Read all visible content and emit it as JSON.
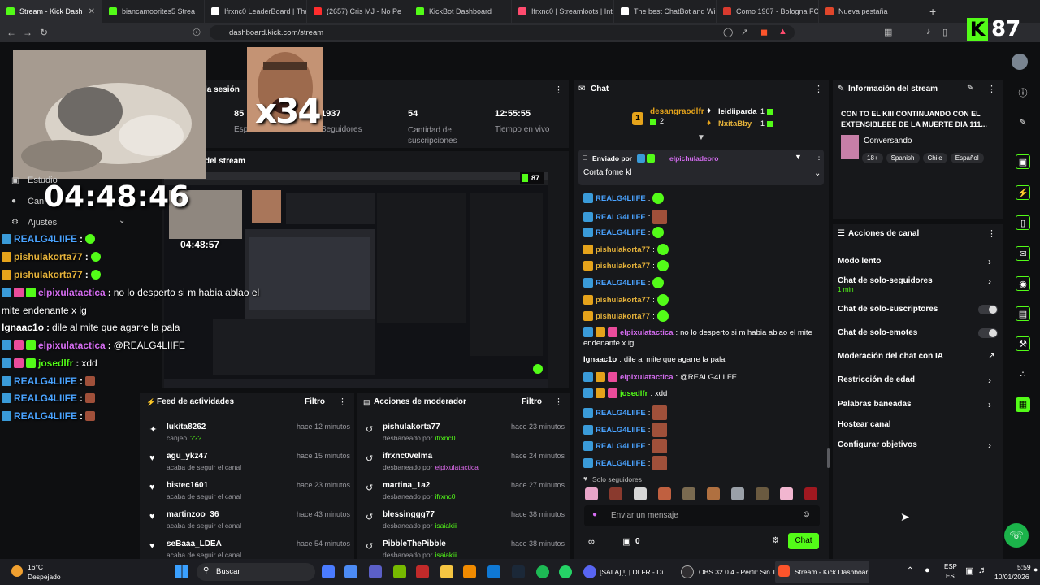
{
  "browser": {
    "tabs": [
      {
        "title": "Stream - Kick Dash",
        "color": "#53fc18",
        "active": true
      },
      {
        "title": "biancamoorites5 Strea",
        "color": "#53fc18"
      },
      {
        "title": "Ifrxnc0 LeaderBoard | The",
        "color": "#ffffff"
      },
      {
        "title": "(2657) Cris MJ - No Pe",
        "color": "#ff2d2d"
      },
      {
        "title": "KickBot Dashboard",
        "color": "#53fc18"
      },
      {
        "title": "Ifrxnc0 | Streamloots | Inte",
        "color": "#ff4b6e"
      },
      {
        "title": "The best ChatBot and Wi",
        "color": "#ffffff"
      },
      {
        "title": "Como 1907 - Bologna FC",
        "color": "#d83a2e"
      },
      {
        "title": "Nueva pestaña",
        "color": "#e0462b"
      }
    ],
    "new_tab": "+",
    "url": "dashboard.kick.com/stream",
    "kick_count": "87"
  },
  "stats": {
    "session_label": "la sesión",
    "items": [
      {
        "value": "85",
        "label": "Espectadores"
      },
      {
        "value": "1937",
        "label": "Seguidores"
      },
      {
        "value": "54",
        "label": "Cantidad de suscripciones"
      },
      {
        "value": "12:55:55",
        "label": "Tiempo en vivo"
      }
    ]
  },
  "overlay": {
    "multiplier": "x34",
    "clock": "04:48:46",
    "preview_title": "del stream",
    "menu_items": [
      "Estudio",
      "Can",
      "Ajustes"
    ],
    "chat": [
      {
        "user": "REALG4LIIFE",
        "sep": ":",
        "msg": "",
        "style": "blue",
        "emote": "green"
      },
      {
        "user": "pishulakorta77",
        "sep": ":",
        "msg": "",
        "style": "gold",
        "emote": "green"
      },
      {
        "user": "pishulakorta77",
        "sep": ":",
        "msg": "",
        "style": "gold",
        "emote": "green"
      },
      {
        "user": "elpixulatactica",
        "sep": ":",
        "msg": "no lo desperto si m habia ablao el",
        "style": "pink",
        "emote": ""
      },
      {
        "user": "",
        "sep": "",
        "msg": "mite endenante x ig",
        "style": "none",
        "emote": ""
      },
      {
        "user": "Ignaac1o",
        "sep": ":",
        "msg": "dile al mite que agarre la pala",
        "style": "plain",
        "emote": ""
      },
      {
        "user": "elpixulatactica",
        "sep": ":",
        "msg": "@REALG4LIIFE",
        "style": "pink",
        "emote": ""
      },
      {
        "user": "josedlfr",
        "sep": ":",
        "msg": "xdd",
        "style": "green",
        "emote": ""
      },
      {
        "user": "REALG4LIIFE",
        "sep": ":",
        "msg": "",
        "style": "blue",
        "emote": "red"
      },
      {
        "user": "REALG4LIIFE",
        "sep": ":",
        "msg": "",
        "style": "blue",
        "emote": "red"
      },
      {
        "user": "REALG4LIIFE",
        "sep": ":",
        "msg": "",
        "style": "blue",
        "emote": "red"
      }
    ],
    "preview_clock": "04:48:57"
  },
  "feed": {
    "title": "Feed de actividades",
    "filter": "Filtro",
    "items": [
      {
        "user": "lukita8262",
        "sub": "canjeó",
        "extra": "???",
        "time": "hace 12 minutos"
      },
      {
        "user": "agu_ykz47",
        "sub": "acaba de seguir el canal",
        "extra": "",
        "time": "hace 15 minutos"
      },
      {
        "user": "bistec1601",
        "sub": "acaba de seguir el canal",
        "extra": "",
        "time": "hace 23 minutos"
      },
      {
        "user": "martinzoo_36",
        "sub": "acaba de seguir el canal",
        "extra": "",
        "time": "hace 43 minutos"
      },
      {
        "user": "seBaaa_LDEA",
        "sub": "acaba de seguir el canal",
        "extra": "",
        "time": "hace 54 minutos"
      }
    ]
  },
  "mod": {
    "title": "Acciones de moderador",
    "filter": "Filtro",
    "items": [
      {
        "user": "pishulakorta77",
        "sub": "desbaneado por",
        "by": "ifrxnc0",
        "time": "hace 23 minutos"
      },
      {
        "user": "ifrxnc0velma",
        "sub": "desbaneado por",
        "by": "elpixulatactica",
        "time": "hace 24 minutos"
      },
      {
        "user": "martina_1a2",
        "sub": "desbaneado por",
        "by": "ifrxnc0",
        "time": "hace 27 minutos"
      },
      {
        "user": "blessinggg77",
        "sub": "desbaneado por",
        "by": "isaiakiii",
        "time": "hace 38 minutos"
      },
      {
        "user": "PibbleThePibble",
        "sub": "desbaneado por",
        "by": "isaiakiii",
        "time": "hace 38 minutos"
      }
    ]
  },
  "chat": {
    "title": "Chat",
    "top_gifters": [
      {
        "rank": "1",
        "name": "desangraodlfr",
        "count": "2"
      },
      {
        "name": "leidiiparda",
        "count": "1"
      },
      {
        "name": "NxitaBby",
        "count": "1"
      }
    ],
    "pinned_label": "Enviado por",
    "pinned_by": "elpichuladeoro",
    "pinned_msg": "Corta fome kl",
    "messages": [
      {
        "user": "REALG4LIIFE",
        "style": "blue",
        "msg": "",
        "emote": "green"
      },
      {
        "user": "REALG4LIIFE",
        "style": "blue",
        "msg": "",
        "emote": "red"
      },
      {
        "user": "REALG4LIIFE",
        "style": "blue",
        "msg": "",
        "emote": "green"
      },
      {
        "user": "pishulakorta77",
        "style": "gold",
        "msg": "",
        "emote": "green"
      },
      {
        "user": "pishulakorta77",
        "style": "gold",
        "msg": "",
        "emote": "green"
      },
      {
        "user": "REALG4LIIFE",
        "style": "blue",
        "msg": "",
        "emote": "green"
      },
      {
        "user": "pishulakorta77",
        "style": "gold",
        "msg": "",
        "emote": "green"
      },
      {
        "user": "pishulakorta77",
        "style": "gold",
        "msg": "",
        "emote": "green"
      },
      {
        "user": "elpixulatactica",
        "style": "pink",
        "msg": "no lo desperto si m habia ablao el mite",
        "emote": ""
      },
      {
        "user": "",
        "style": "none",
        "msg": "endenante x ig",
        "emote": ""
      },
      {
        "user": "Ignaac1o",
        "style": "plain",
        "msg": "dile al mite que agarre la pala",
        "emote": ""
      },
      {
        "user": "elpixulatactica",
        "style": "pink",
        "msg": "@REALG4LIIFE",
        "emote": ""
      },
      {
        "user": "josedlfr",
        "style": "green",
        "msg": "xdd",
        "emote": ""
      },
      {
        "user": "REALG4LIIFE",
        "style": "blue",
        "msg": "",
        "emote": "red"
      },
      {
        "user": "REALG4LIIFE",
        "style": "blue",
        "msg": "",
        "emote": "red"
      },
      {
        "user": "REALG4LIIFE",
        "style": "blue",
        "msg": "",
        "emote": "red"
      },
      {
        "user": "REALG4LIIFE",
        "style": "blue",
        "msg": "",
        "emote": "red"
      }
    ],
    "followers_only": "Solo seguidores",
    "input_placeholder": "Enviar un mensaje",
    "send_label": "Chat",
    "count": "0"
  },
  "stream_info": {
    "title": "Información del stream",
    "stream_title": "CON TO EL KIII CONTINUANDO CON EL EXTENSIBLEEE DE LA MUERTE DIA 111...",
    "category": "Conversando",
    "tags": [
      "18+",
      "Spanish",
      "Chile",
      "Español"
    ]
  },
  "channel_actions": {
    "title": "Acciones de canal",
    "items": [
      {
        "label": "Modo lento",
        "sub": "",
        "control": "chevron"
      },
      {
        "label": "Chat de solo-seguidores",
        "sub": "1 min",
        "control": "chevron"
      },
      {
        "label": "Chat de solo-suscriptores",
        "sub": "",
        "control": "toggle"
      },
      {
        "label": "Chat de solo-emotes",
        "sub": "",
        "control": "toggle"
      },
      {
        "label": "Moderación del chat con IA",
        "sub": "",
        "control": "external"
      },
      {
        "label": "Restricción de edad",
        "sub": "",
        "control": "chevron"
      },
      {
        "label": "Palabras baneadas",
        "sub": "",
        "control": "chevron"
      },
      {
        "label": "Hostear canal",
        "sub": "",
        "control": "none"
      },
      {
        "label": "Configurar objetivos",
        "sub": "",
        "control": "chevron"
      }
    ]
  },
  "taskbar": {
    "weather_temp": "16°C",
    "weather_desc": "Despejado",
    "search": "Buscar",
    "apps": [
      "[SALA][!] | DLFR - Di",
      "OBS 32.0.4 - Perfil: Sin T",
      "Stream - Kick Dashboar"
    ],
    "lang1": "ESP",
    "lang2": "ES",
    "time": "5:59",
    "date": "10/01/2026"
  }
}
